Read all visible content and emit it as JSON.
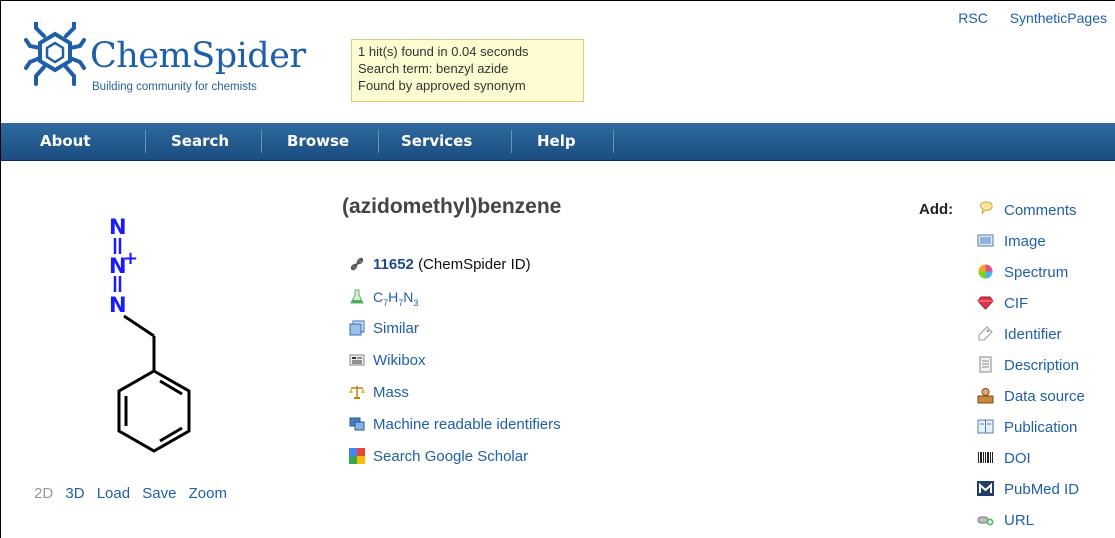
{
  "header": {
    "logo_title": "ChemSpider",
    "logo_tagline": "Building community for chemists",
    "search_info": {
      "hits": "1 hit(s) found in 0.04 seconds",
      "term": "Search term: benzyl azide",
      "found_by": "Found by approved synonym"
    },
    "top_links": [
      "RSC",
      "SyntheticPages"
    ]
  },
  "nav": {
    "items": [
      "About",
      "Search",
      "Browse",
      "Services",
      "Help"
    ]
  },
  "structure": {
    "atom_n": "N",
    "charge": "+",
    "viewer_links": [
      "2D",
      "3D",
      "Load",
      "Save",
      "Zoom"
    ]
  },
  "compound": {
    "name": "(azidomethyl)benzene",
    "id": "11652",
    "id_label": "(ChemSpider ID)",
    "formula": {
      "c": "C",
      "c_n": "7",
      "h": "H",
      "h_n": "7",
      "n": "N",
      "n_n": "3"
    },
    "links": [
      "Similar",
      "Wikibox",
      "Mass",
      "Machine readable identifiers",
      "Search Google Scholar"
    ]
  },
  "add": {
    "label": "Add:",
    "items": [
      {
        "label": "Comments",
        "icon": "comments-icon"
      },
      {
        "label": "Image",
        "icon": "image-icon"
      },
      {
        "label": "Spectrum",
        "icon": "spectrum-icon"
      },
      {
        "label": "CIF",
        "icon": "cif-gem-icon"
      },
      {
        "label": "Identifier",
        "icon": "identifier-tag-icon"
      },
      {
        "label": "Description",
        "icon": "description-icon"
      },
      {
        "label": "Data source",
        "icon": "data-source-icon"
      },
      {
        "label": "Publication",
        "icon": "publication-icon"
      },
      {
        "label": "DOI",
        "icon": "doi-barcode-icon"
      },
      {
        "label": "PubMed ID",
        "icon": "pubmed-icon"
      },
      {
        "label": "URL",
        "icon": "url-icon"
      }
    ]
  },
  "colors": {
    "brand_blue": "#1f5fa8",
    "nav_bg": "#2562a0",
    "search_box_bg": "#fdfcd1",
    "atom_blue": "#1a1aff"
  }
}
